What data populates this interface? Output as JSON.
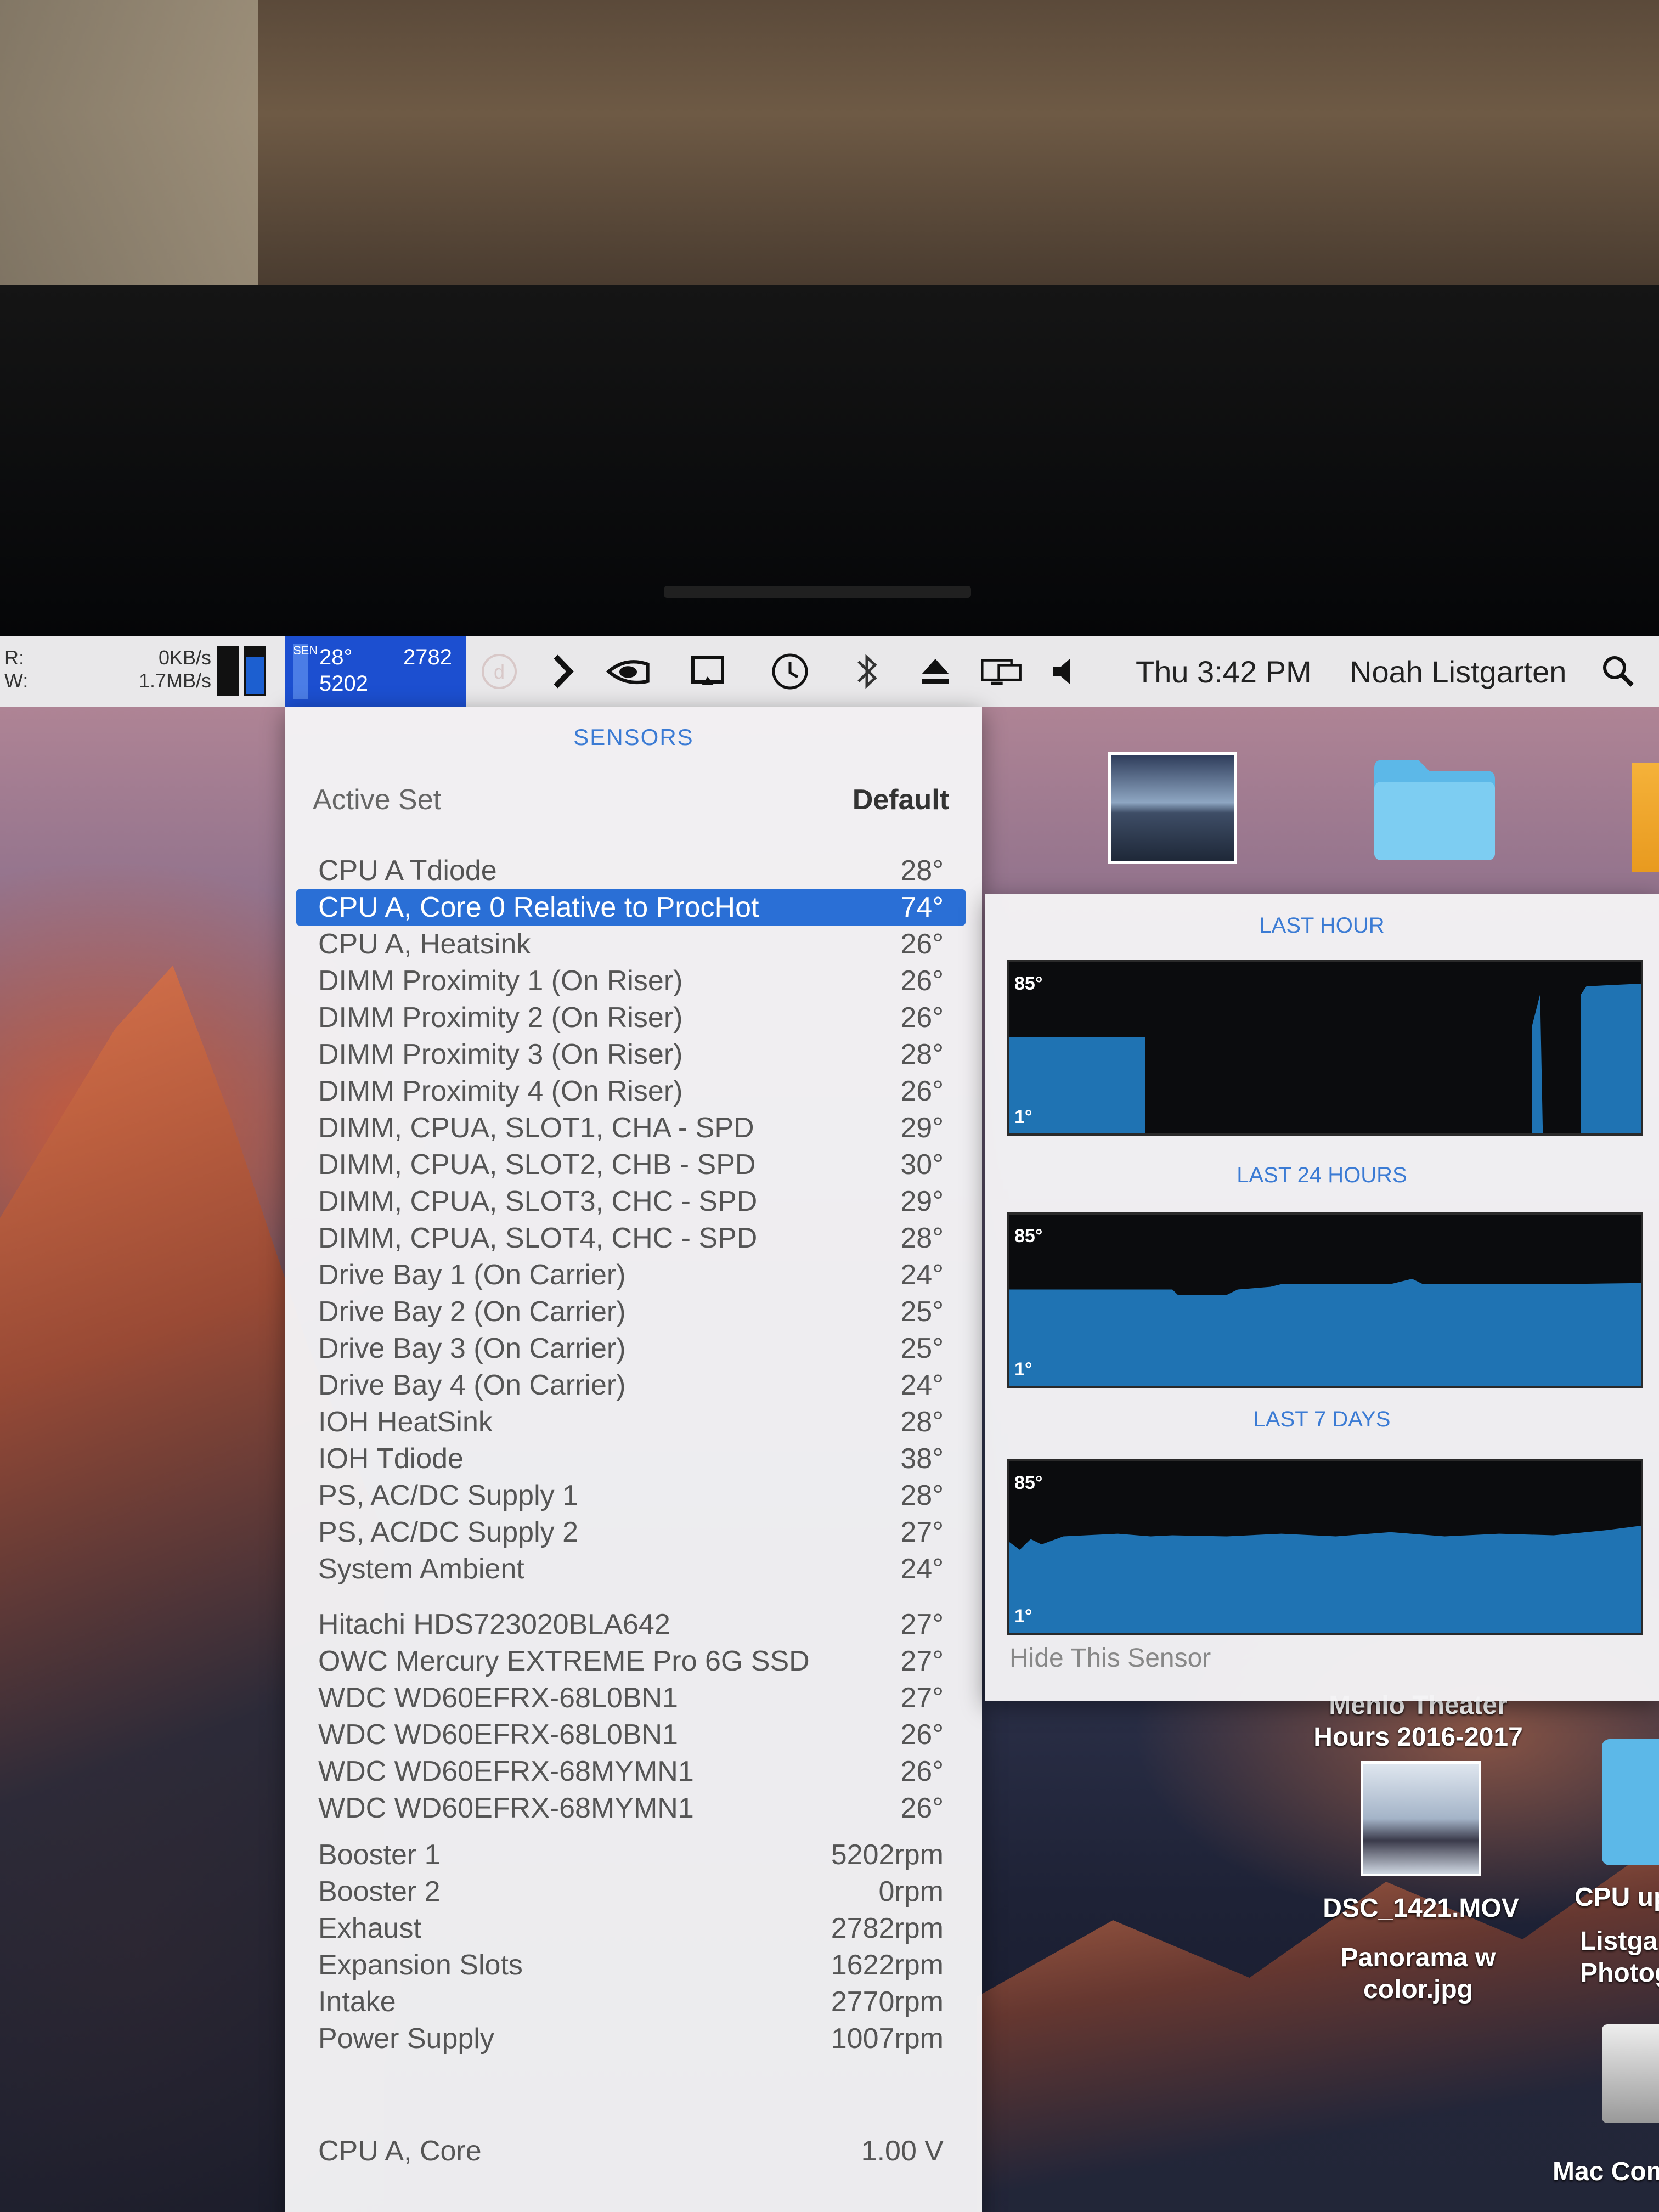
{
  "menubar": {
    "istat_net": {
      "read_label": "R:",
      "write_label": "W:",
      "read_value": "0KB/s",
      "write_value": "1.7MB/s"
    },
    "istat_sensors": {
      "temp": "28°",
      "fan_rpm": "2782",
      "second_rpm": "5202"
    },
    "icons": [
      "istat-disabled-icon",
      "chevron-right-icon",
      "nvidia-icon",
      "airplay-mirror-icon",
      "time-machine-icon",
      "bluetooth-icon",
      "eject-icon",
      "display-icon",
      "volume-icon"
    ],
    "clock": "Thu 3:42 PM",
    "user": "Noah Listgarten",
    "search_icon": "search-icon"
  },
  "dropdown": {
    "title": "SENSORS",
    "active_set_label": "Active Set",
    "active_set_value": "Default",
    "temperature_sensors": [
      {
        "name": "CPU A Tdiode",
        "value": "28°"
      },
      {
        "name": "CPU A, Core 0 Relative to ProcHot",
        "value": "74°",
        "selected": true
      },
      {
        "name": "CPU A, Heatsink",
        "value": "26°"
      },
      {
        "name": "DIMM Proximity 1 (On Riser)",
        "value": "26°"
      },
      {
        "name": "DIMM Proximity 2 (On Riser)",
        "value": "26°"
      },
      {
        "name": "DIMM Proximity 3 (On Riser)",
        "value": "28°"
      },
      {
        "name": "DIMM Proximity 4 (On Riser)",
        "value": "26°"
      },
      {
        "name": "DIMM, CPUA, SLOT1, CHA - SPD",
        "value": "29°"
      },
      {
        "name": "DIMM, CPUA, SLOT2, CHB - SPD",
        "value": "30°"
      },
      {
        "name": "DIMM, CPUA, SLOT3, CHC - SPD",
        "value": "29°"
      },
      {
        "name": "DIMM, CPUA, SLOT4, CHC - SPD",
        "value": "28°"
      },
      {
        "name": "Drive Bay 1 (On Carrier)",
        "value": "24°"
      },
      {
        "name": "Drive Bay 2 (On Carrier)",
        "value": "25°"
      },
      {
        "name": "Drive Bay 3 (On Carrier)",
        "value": "25°"
      },
      {
        "name": "Drive Bay 4 (On Carrier)",
        "value": "24°"
      },
      {
        "name": "IOH HeatSink",
        "value": "28°"
      },
      {
        "name": "IOH Tdiode",
        "value": "38°"
      },
      {
        "name": "PS, AC/DC Supply 1",
        "value": "28°"
      },
      {
        "name": "PS, AC/DC Supply 2",
        "value": "27°"
      },
      {
        "name": "System Ambient",
        "value": "24°"
      }
    ],
    "drive_sensors": [
      {
        "name": "Hitachi HDS723020BLA642",
        "value": "27°"
      },
      {
        "name": "OWC Mercury EXTREME Pro 6G SSD",
        "value": "27°"
      },
      {
        "name": "WDC WD60EFRX-68L0BN1",
        "value": "27°"
      },
      {
        "name": "WDC WD60EFRX-68L0BN1",
        "value": "26°"
      },
      {
        "name": "WDC WD60EFRX-68MYMN1",
        "value": "26°"
      },
      {
        "name": "WDC WD60EFRX-68MYMN1",
        "value": "26°"
      }
    ],
    "fan_sensors": [
      {
        "name": "Booster 1",
        "value": "5202rpm"
      },
      {
        "name": "Booster 2",
        "value": "0rpm"
      },
      {
        "name": "Exhaust",
        "value": "2782rpm"
      },
      {
        "name": "Expansion Slots",
        "value": "1622rpm"
      },
      {
        "name": "Intake",
        "value": "2770rpm"
      },
      {
        "name": "Power Supply",
        "value": "1007rpm"
      }
    ],
    "voltage_sensors": [
      {
        "name": "CPU A, Core",
        "value": "1.00 V"
      }
    ]
  },
  "history": {
    "graphs": [
      {
        "title": "LAST HOUR",
        "max": "85°",
        "min": "1°"
      },
      {
        "title": "LAST 24 HOURS",
        "max": "85°",
        "min": "1°"
      },
      {
        "title": "LAST 7 DAYS",
        "max": "85°",
        "min": "1°"
      }
    ],
    "hide_label": "Hide This Sensor",
    "graph_color": "#1f73b3"
  },
  "desktop": {
    "items": [
      {
        "label": "Menlo Theater Hours 2016-2017"
      },
      {
        "label": "DSC_1421.MOV"
      },
      {
        "label": "Panorama w color.jpg"
      },
      {
        "label": "CPU up"
      },
      {
        "label": "Listga Photog"
      },
      {
        "label": "Mac Com"
      }
    ]
  }
}
